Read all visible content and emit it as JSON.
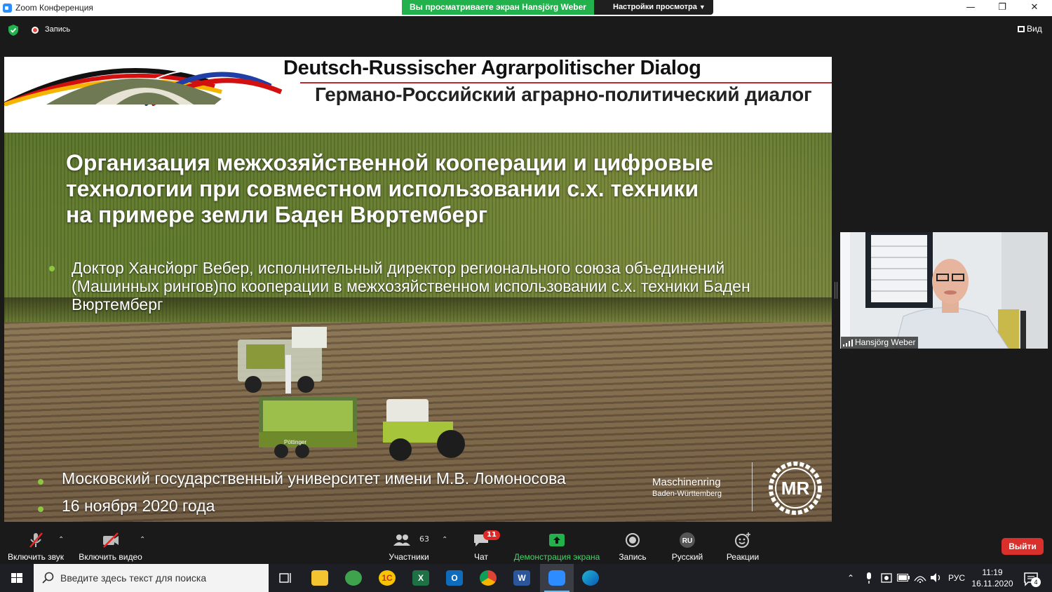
{
  "window": {
    "title": "Zoom Конференция",
    "share_banner": "Вы просматриваете экран Hansjörg Weber",
    "view_settings": "Настройки просмотра"
  },
  "meeting": {
    "recording_label": "Запись",
    "view_label": "Вид"
  },
  "slide": {
    "header_de": "Deutsch-Russischer Agrarpolitischer Dialog",
    "header_ru": "Германо-Российский аграрно-политический диалог",
    "heading_lines": [
      "Организация межхозяйственной кооперации и цифровые",
      "технологии при совместном использовании с.х. техники",
      "на примере земли Баден Вюртемберг"
    ],
    "speaker_lines": [
      "Доктор Хансйорг Вебер, исполнительный директор регионального союза объединений",
      "(Машинных рингов)по кооперации в межхозяйственном использовании с.х. техники Баден",
      "Вюртемберг"
    ],
    "footer_university": "Московский государственный университет имени М.В. Ломоносова",
    "footer_date": "16 ноября 2020 года",
    "brand_name": "Maschinenring",
    "brand_region": "Baden-Württemberg",
    "brand_logo_text": "MR",
    "trailer_text": "Pöttinger"
  },
  "participant": {
    "name": "Hansjörg Weber"
  },
  "toolbar": {
    "unmute_label": "Включить звук",
    "video_label": "Включить видео",
    "participants_label": "Участники",
    "participants_count": "63",
    "chat_label": "Чат",
    "chat_badge": "11",
    "share_label": "Демонстрация экрана",
    "record_label": "Запись",
    "language_label": "Русский",
    "language_code": "RU",
    "reactions_label": "Реакции",
    "leave_label": "Выйти"
  },
  "taskbar": {
    "search_placeholder": "Введите здесь текст для поиска",
    "language": "РУС",
    "time": "11:19",
    "date": "16.11.2020",
    "notification_count": "4",
    "apps": [
      "task-view",
      "file-explorer",
      "maps",
      "1c",
      "excel",
      "outlook",
      "chrome",
      "word",
      "zoom",
      "edge"
    ]
  },
  "colors": {
    "share_green": "#23b14d",
    "share_green_label": "#4ad06b",
    "leave_red": "#d9302c",
    "zoom_blue": "#2D8CFF",
    "badge_red": "#e02828",
    "bullet_green": "#8dc63f"
  }
}
